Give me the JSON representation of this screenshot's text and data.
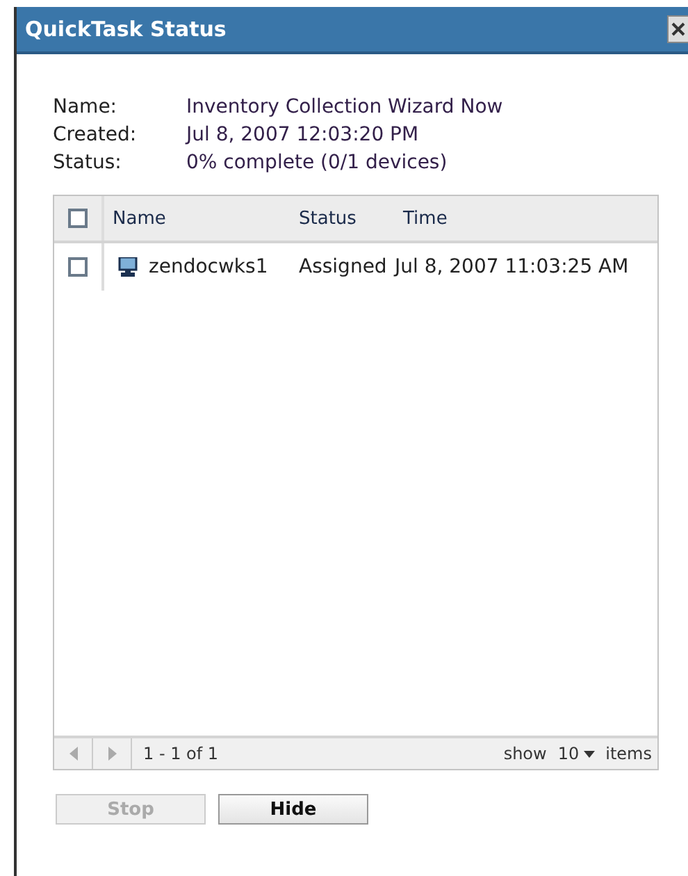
{
  "window": {
    "title": "QuickTask Status"
  },
  "details": [
    {
      "label": "Name:",
      "value": "Inventory Collection Wizard Now"
    },
    {
      "label": "Created:",
      "value": "Jul 8, 2007 12:03:20 PM"
    },
    {
      "label": "Status:",
      "value": "0% complete (0/1 devices)"
    }
  ],
  "table": {
    "select_all": {
      "checked": false
    },
    "columns": [
      "Name",
      "Status",
      "Time"
    ],
    "rows": [
      {
        "checked": false,
        "name": "zendocwks1",
        "status": "Assigned",
        "time": "Jul 8, 2007 11:03:25 AM"
      }
    ]
  },
  "pager": {
    "range": "1 - 1 of 1",
    "show_label": "show",
    "page_size": "10",
    "items_label": "items"
  },
  "buttons": [
    {
      "label": "Stop",
      "disabled": true
    },
    {
      "label": "Hide",
      "disabled": false
    }
  ]
}
